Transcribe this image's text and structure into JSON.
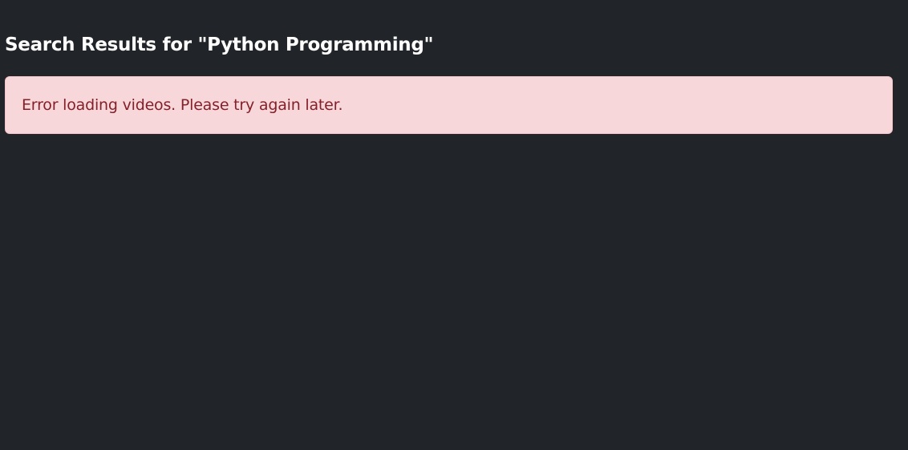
{
  "page": {
    "title": "Search Results for \"Python Programming\""
  },
  "alert": {
    "message": "Error loading videos. Please try again later."
  },
  "colors": {
    "background": "#212529",
    "title_text": "#ffffff",
    "alert_background": "#f8d7da",
    "alert_text": "#842029"
  }
}
